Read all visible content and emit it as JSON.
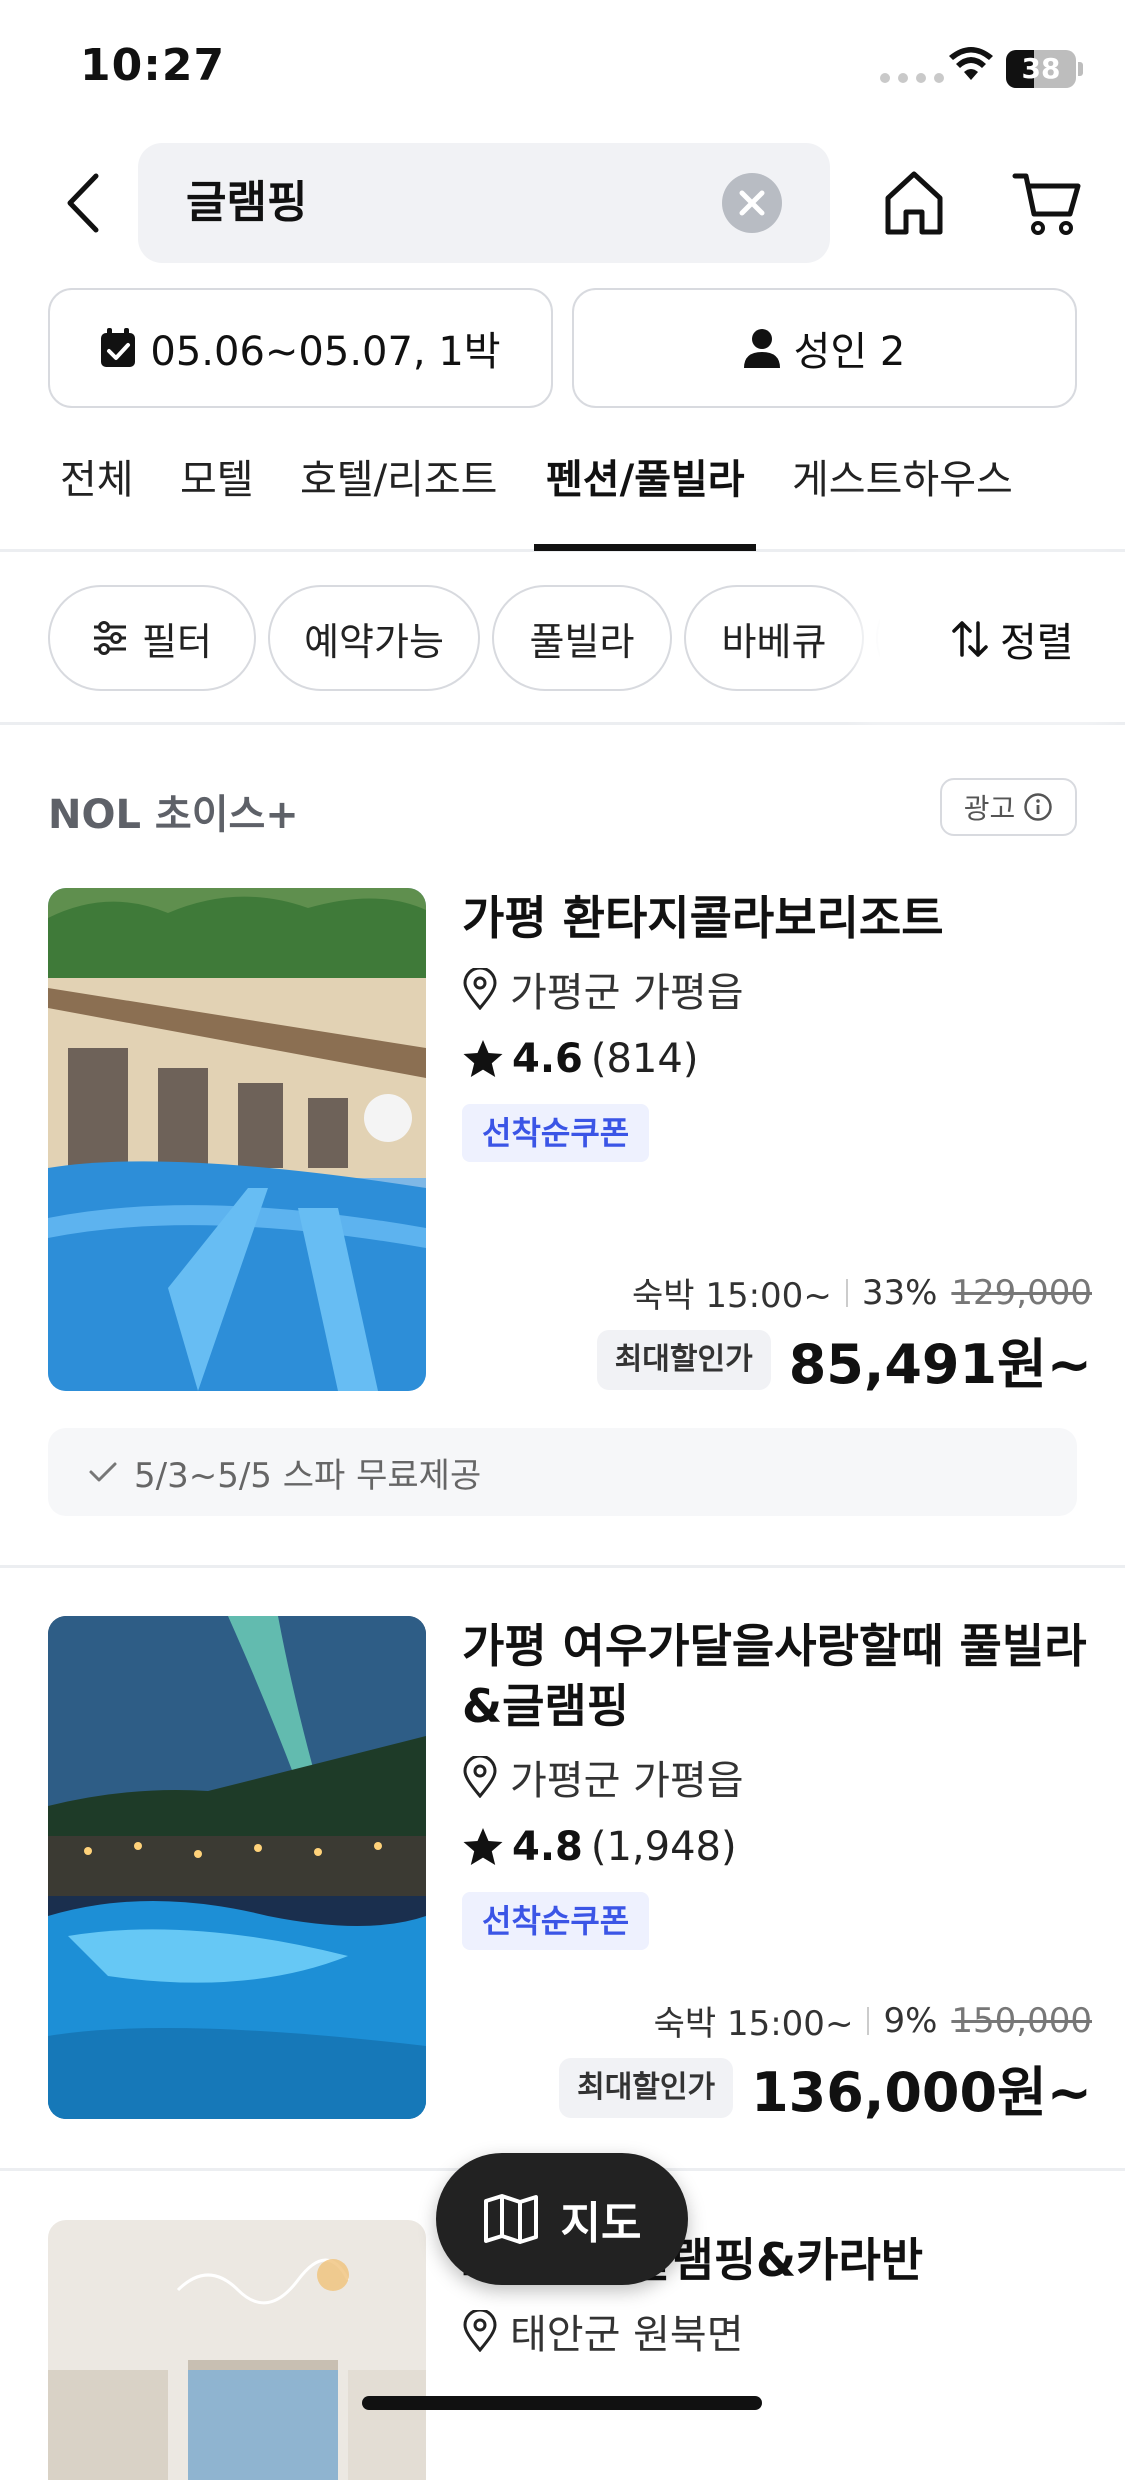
{
  "status_bar": {
    "time": "10:27",
    "battery": "38"
  },
  "search": {
    "query": "글램핑"
  },
  "booking": {
    "dates": "05.06~05.07, 1박",
    "guests": "성인 2"
  },
  "tabs": [
    {
      "label": "전체"
    },
    {
      "label": "모텔"
    },
    {
      "label": "호텔/리조트"
    },
    {
      "label": "펜션/풀빌라",
      "active": true
    },
    {
      "label": "게스트하우스"
    }
  ],
  "filters": {
    "filter_label": "필터",
    "chips": [
      "예약가능",
      "풀빌라",
      "바베큐"
    ],
    "sort_label": "정렬"
  },
  "section": {
    "title": "NOL 초이스+",
    "ad_label": "광고"
  },
  "listings": [
    {
      "name": "가평 환타지콜라보리조트",
      "location": "가평군 가평읍",
      "rating": "4.6",
      "review_count": "(814)",
      "coupon": "선착순쿠폰",
      "checkin": "숙박 15:00~",
      "discount": "33%",
      "original_price": "129,000",
      "max_discount_label": "최대할인가",
      "final_price": "85,491원~",
      "notice": "5/3~5/5 스파 무료제공"
    },
    {
      "name": "가평 여우가달을사랑할때 풀빌라 &글램핑",
      "location": "가평군 가평읍",
      "rating": "4.8",
      "review_count": "(1,948)",
      "coupon": "선착순쿠폰",
      "checkin": "숙박 15:00~",
      "discount": "9%",
      "original_price": "150,000",
      "max_discount_label": "최대할인가",
      "final_price": "136,000원~"
    },
    {
      "name": "르펜션&글램핑&카라반",
      "location": "태안군 원북면"
    }
  ],
  "map_button": {
    "label": "지도"
  }
}
